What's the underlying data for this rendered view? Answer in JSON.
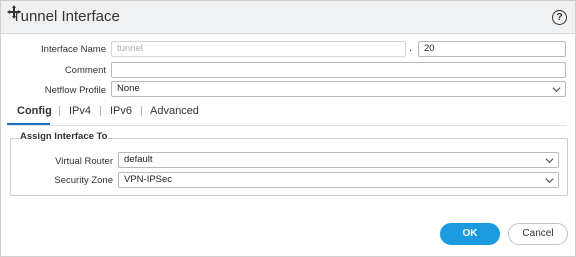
{
  "dialog": {
    "title": "Tunnel Interface",
    "help_icon": "?",
    "icons": {
      "move": "move-icon",
      "help": "help-icon"
    }
  },
  "form": {
    "interface_name": {
      "label": "Interface Name",
      "value": "tunnel",
      "separator": ".",
      "suffix": "20"
    },
    "comment": {
      "label": "Comment",
      "value": ""
    },
    "netflow_profile": {
      "label": "Netflow Profile",
      "value": "None"
    }
  },
  "tabs": [
    {
      "label": "Config"
    },
    {
      "label": "IPv4"
    },
    {
      "label": "IPv6"
    },
    {
      "label": "Advanced"
    }
  ],
  "tab_separator": "|",
  "assign": {
    "legend": "Assign Interface To",
    "virtual_router": {
      "label": "Virtual Router",
      "value": "default"
    },
    "security_zone": {
      "label": "Security Zone",
      "value": "VPN-IPSec"
    }
  },
  "buttons": {
    "ok": "OK",
    "cancel": "Cancel"
  },
  "colors": {
    "accent": "#1a9be0",
    "titlebar": "#f0f1f3"
  }
}
